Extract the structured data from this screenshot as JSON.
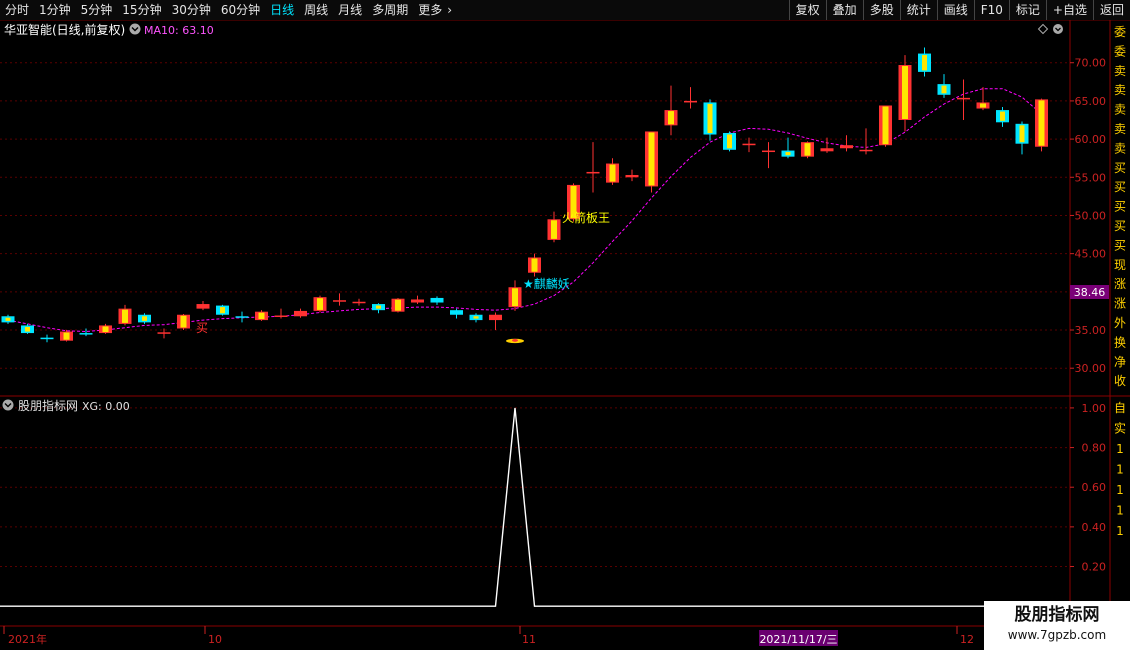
{
  "toolbar": {
    "periods": [
      "分时",
      "1分钟",
      "5分钟",
      "15分钟",
      "30分钟",
      "60分钟",
      "日线",
      "周线",
      "月线",
      "多周期",
      "更多"
    ],
    "active": "日线",
    "more_arrow": "›",
    "right": [
      "复权",
      "叠加",
      "多股",
      "统计",
      "画线",
      "F10",
      "标记",
      "+自选",
      "返回"
    ]
  },
  "header": {
    "stock": "华亚智能(日线,前复权)",
    "indicator": "MA10: 63.10",
    "collapse_icon": "circle-chevron-icon",
    "diamond_icon": "diamond-icon"
  },
  "sub_header": {
    "title": "股朋指标网",
    "value": "XG: 0.00"
  },
  "price_label": "38.46",
  "date_highlight": "2021/11/17/三",
  "x_labels": [
    "2021年",
    "10",
    "11",
    "12"
  ],
  "right_strip": {
    "upper": [
      "委",
      "委",
      "卖",
      "卖",
      "卖",
      "卖",
      "卖",
      "买",
      "买",
      "买",
      "买",
      "买",
      "现",
      "涨",
      "涨",
      "外",
      "换",
      "净",
      "收"
    ],
    "lower": [
      "自",
      "实",
      "1",
      "1",
      "1",
      "1",
      "1"
    ]
  },
  "annotations": {
    "buy": "买",
    "rocket": "火箭板王",
    "qilin": "★麒麟妖"
  },
  "watermark": {
    "title": "股朋指标网",
    "url": "www.7gpzb.com"
  },
  "colors": {
    "up": "#ff3232",
    "down": "#00e5ff",
    "ma": "#ff00ff",
    "grid": "#5a0000",
    "axis": "#cc2222"
  },
  "chart_data": [
    {
      "type": "candlestick",
      "title": "华亚智能(日线,前复权)",
      "y_ticks": [
        30,
        35,
        40,
        45,
        50,
        55,
        60,
        65,
        70
      ],
      "ylim": [
        27.8,
        73.5
      ],
      "ma10_last": 63.1,
      "candles": [
        {
          "o": 36.8,
          "c": 36.0,
          "h": 37.0,
          "l": 35.8
        },
        {
          "o": 35.6,
          "c": 34.6,
          "h": 35.8,
          "l": 34.5
        },
        {
          "o": 34.0,
          "c": 33.8,
          "h": 34.4,
          "l": 33.4
        },
        {
          "o": 33.6,
          "c": 34.8,
          "h": 35.0,
          "l": 33.5
        },
        {
          "o": 34.6,
          "c": 34.5,
          "h": 35.2,
          "l": 34.2
        },
        {
          "o": 34.6,
          "c": 35.6,
          "h": 35.8,
          "l": 34.5
        },
        {
          "o": 35.8,
          "c": 37.8,
          "h": 38.3,
          "l": 35.6
        },
        {
          "o": 37.0,
          "c": 36.0,
          "h": 37.2,
          "l": 35.8
        },
        {
          "o": 34.6,
          "c": 34.7,
          "h": 35.2,
          "l": 33.9
        },
        {
          "o": 35.2,
          "c": 37.0,
          "h": 37.1,
          "l": 35.0
        },
        {
          "o": 37.8,
          "c": 38.4,
          "h": 38.8,
          "l": 37.6
        },
        {
          "o": 38.2,
          "c": 37.0,
          "h": 38.3,
          "l": 36.9
        },
        {
          "o": 36.8,
          "c": 36.6,
          "h": 37.4,
          "l": 36.0
        },
        {
          "o": 36.3,
          "c": 37.4,
          "h": 37.6,
          "l": 36.2
        },
        {
          "o": 36.8,
          "c": 36.9,
          "h": 37.8,
          "l": 36.5
        },
        {
          "o": 36.8,
          "c": 37.5,
          "h": 37.8,
          "l": 36.6
        },
        {
          "o": 37.5,
          "c": 39.3,
          "h": 39.5,
          "l": 37.3
        },
        {
          "o": 38.8,
          "c": 38.9,
          "h": 39.8,
          "l": 38.2
        },
        {
          "o": 38.6,
          "c": 38.7,
          "h": 39.1,
          "l": 38.2
        },
        {
          "o": 38.4,
          "c": 37.6,
          "h": 38.5,
          "l": 37.2
        },
        {
          "o": 37.4,
          "c": 39.1,
          "h": 39.2,
          "l": 37.3
        },
        {
          "o": 38.6,
          "c": 39.0,
          "h": 39.5,
          "l": 38.4
        },
        {
          "o": 39.2,
          "c": 38.6,
          "h": 39.4,
          "l": 38.3
        },
        {
          "o": 37.6,
          "c": 37.0,
          "h": 37.8,
          "l": 36.5
        },
        {
          "o": 37.0,
          "c": 36.3,
          "h": 37.2,
          "l": 36.0
        },
        {
          "o": 36.3,
          "c": 37.0,
          "h": 37.3,
          "l": 35.0
        },
        {
          "o": 38.0,
          "c": 40.6,
          "h": 41.5,
          "l": 37.5
        },
        {
          "o": 42.5,
          "c": 44.5,
          "h": 45.0,
          "l": 42.0
        },
        {
          "o": 46.8,
          "c": 49.5,
          "h": 50.5,
          "l": 46.5
        },
        {
          "o": 49.5,
          "c": 54.0,
          "h": 54.2,
          "l": 49.2
        },
        {
          "o": 55.5,
          "c": 55.7,
          "h": 59.6,
          "l": 53.0
        },
        {
          "o": 54.3,
          "c": 56.8,
          "h": 57.5,
          "l": 54.0
        },
        {
          "o": 55.0,
          "c": 55.3,
          "h": 56.0,
          "l": 54.5
        },
        {
          "o": 53.8,
          "c": 61.0,
          "h": 61.0,
          "l": 53.0
        },
        {
          "o": 61.8,
          "c": 63.8,
          "h": 67.0,
          "l": 60.5
        },
        {
          "o": 64.8,
          "c": 65.0,
          "h": 66.8,
          "l": 64.0
        },
        {
          "o": 64.8,
          "c": 60.6,
          "h": 65.2,
          "l": 59.8
        },
        {
          "o": 60.8,
          "c": 58.6,
          "h": 61.0,
          "l": 58.4
        },
        {
          "o": 59.2,
          "c": 59.4,
          "h": 60.2,
          "l": 58.3
        },
        {
          "o": 58.4,
          "c": 58.5,
          "h": 59.6,
          "l": 56.2
        },
        {
          "o": 58.5,
          "c": 57.7,
          "h": 60.2,
          "l": 57.5
        },
        {
          "o": 57.7,
          "c": 59.6,
          "h": 59.7,
          "l": 57.5
        },
        {
          "o": 58.4,
          "c": 58.8,
          "h": 60.2,
          "l": 58.2
        },
        {
          "o": 58.8,
          "c": 59.2,
          "h": 60.5,
          "l": 58.4
        },
        {
          "o": 58.5,
          "c": 58.6,
          "h": 61.4,
          "l": 58.0
        },
        {
          "o": 59.2,
          "c": 64.4,
          "h": 64.4,
          "l": 59.0
        },
        {
          "o": 62.5,
          "c": 69.7,
          "h": 71.0,
          "l": 61.0
        },
        {
          "o": 71.2,
          "c": 68.8,
          "h": 72.0,
          "l": 68.2
        },
        {
          "o": 67.2,
          "c": 65.8,
          "h": 68.5,
          "l": 65.4
        },
        {
          "o": 65.2,
          "c": 65.4,
          "h": 67.8,
          "l": 62.5
        },
        {
          "o": 64.0,
          "c": 64.8,
          "h": 66.8,
          "l": 63.8
        },
        {
          "o": 63.8,
          "c": 62.2,
          "h": 64.2,
          "l": 61.6
        },
        {
          "o": 62.0,
          "c": 59.4,
          "h": 62.3,
          "l": 58.0
        },
        {
          "o": 59.0,
          "c": 65.2,
          "h": 65.3,
          "l": 58.4
        }
      ],
      "ma10": [
        36.3,
        35.8,
        35.3,
        34.9,
        34.8,
        35.0,
        35.3,
        35.6,
        35.7,
        36.0,
        36.3,
        36.5,
        36.6,
        36.7,
        36.8,
        37.0,
        37.3,
        37.5,
        37.7,
        37.8,
        37.9,
        38.0,
        38.0,
        37.9,
        37.7,
        37.6,
        37.8,
        38.4,
        39.5,
        41.3,
        43.8,
        46.6,
        49.3,
        52.3,
        55.1,
        57.6,
        59.6,
        60.8,
        61.4,
        61.3,
        60.8,
        60.1,
        59.5,
        59.1,
        58.9,
        59.4,
        60.9,
        62.9,
        64.6,
        65.9,
        66.6,
        66.6,
        65.5,
        63.3
      ],
      "signal_marker_index": 26
    },
    {
      "type": "line",
      "title": "股朋指标网",
      "series_label": "XG: 0.00",
      "y_ticks": [
        0.2,
        0.4,
        0.6,
        0.8,
        1.0
      ],
      "ylim": [
        -0.1,
        1.05
      ],
      "values": [
        0,
        0,
        0,
        0,
        0,
        0,
        0,
        0,
        0,
        0,
        0,
        0,
        0,
        0,
        0,
        0,
        0,
        0,
        0,
        0,
        0,
        0,
        0,
        0,
        0,
        0,
        1,
        0,
        0,
        0,
        0,
        0,
        0,
        0,
        0,
        0,
        0,
        0,
        0,
        0,
        0,
        0,
        0,
        0,
        0,
        0,
        0,
        0,
        0,
        0,
        0,
        0,
        0,
        0
      ]
    }
  ]
}
